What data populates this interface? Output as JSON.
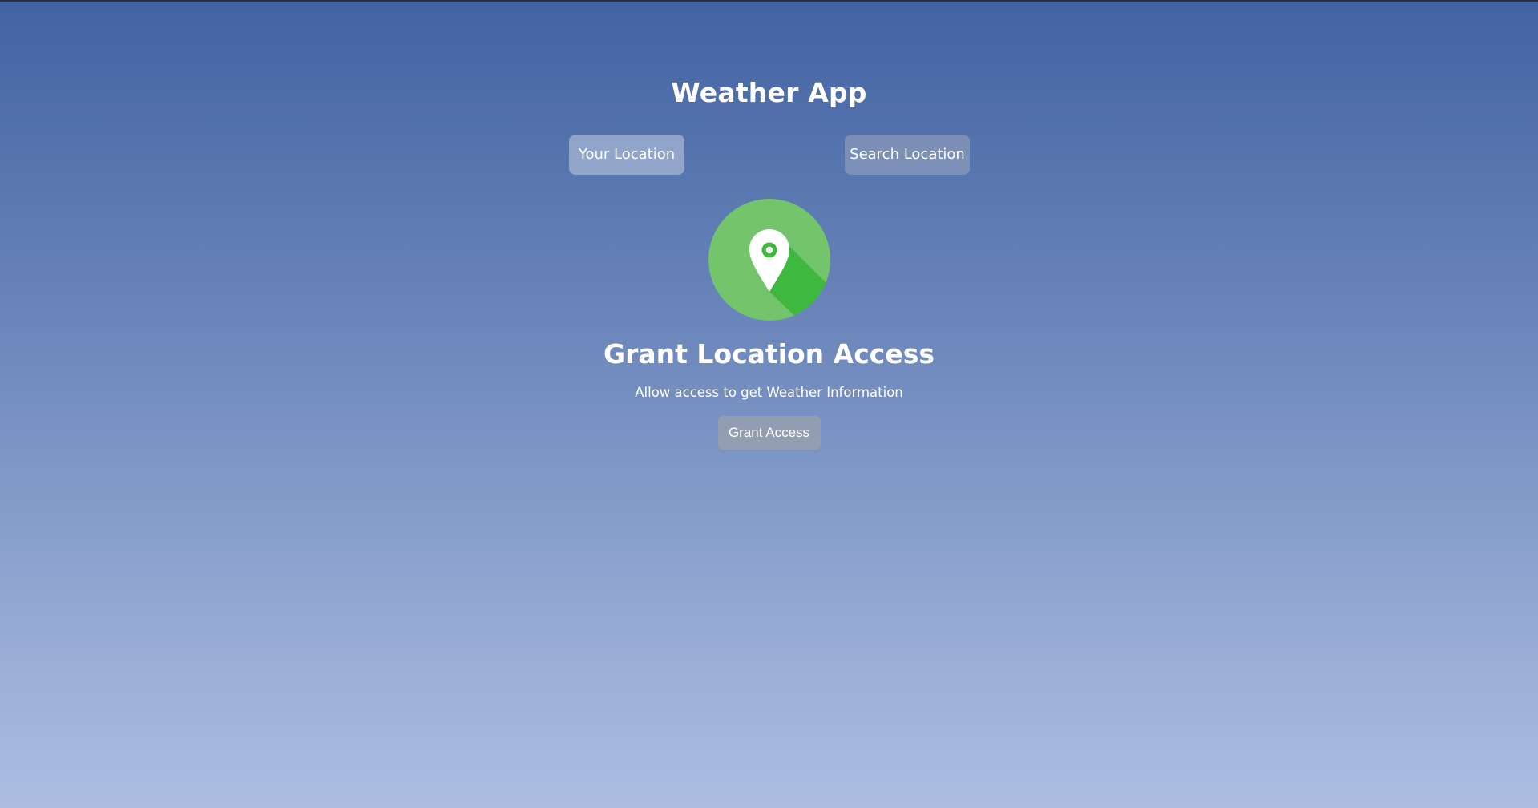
{
  "app": {
    "title": "Weather App"
  },
  "tabs": [
    {
      "label": "Your Location",
      "active": true
    },
    {
      "label": "Search Location",
      "active": false
    }
  ],
  "grant": {
    "icon": "location-pin-icon",
    "heading": "Grant Location Access",
    "subtext": "Allow access to get Weather Information",
    "button_label": "Grant Access"
  },
  "colors": {
    "background_top": "#4263a2",
    "background_bottom": "#adbde2",
    "icon_circle": "#73c46a",
    "icon_shadow": "#3fb83f",
    "icon_pin": "#ffffff"
  }
}
